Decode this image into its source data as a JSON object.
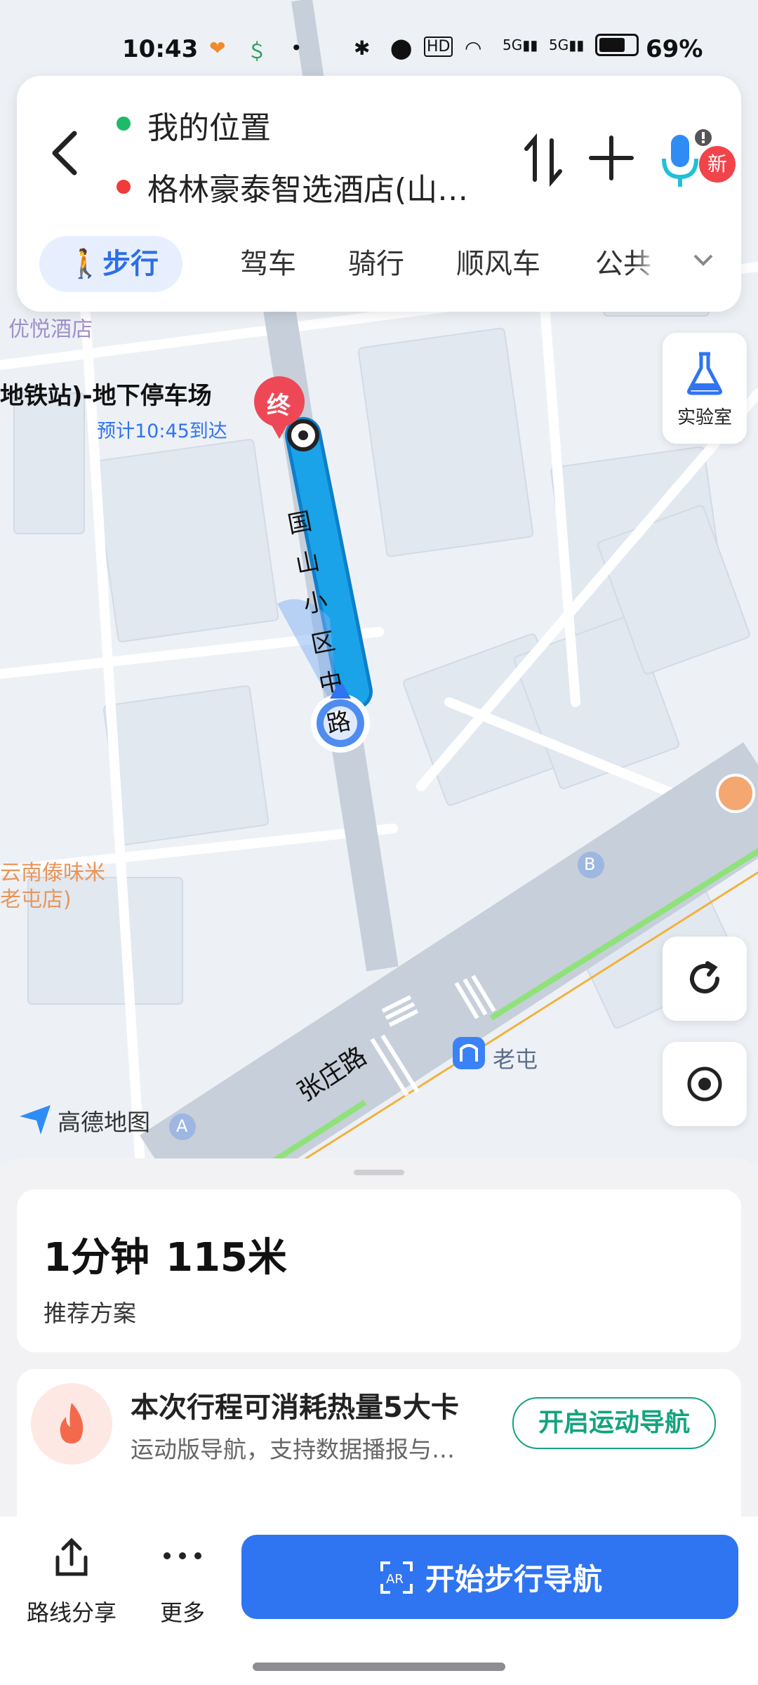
{
  "status_bar": {
    "time": "10:43",
    "network_1": "5G",
    "network_2": "5G",
    "battery": "69%"
  },
  "route": {
    "origin": "我的位置",
    "destination": "格林豪泰智选酒店(山…"
  },
  "tabs": [
    {
      "label": "步行",
      "active": true
    },
    {
      "label": "驾车"
    },
    {
      "label": "骑行"
    },
    {
      "label": "顺风车"
    },
    {
      "label": "公共"
    }
  ],
  "new_badge": "新",
  "lab_button": {
    "label": "实验室"
  },
  "map": {
    "poi_hotel": "优悦酒店",
    "poi_parking": "地铁站)-地下停车场",
    "eta": "预计10:45到达",
    "end_marker": "终",
    "street_route": "国山小区中路",
    "street_main": "张庄路",
    "poi_restaurant_1": "云南傣味米",
    "poi_restaurant_2": "老屯店)",
    "metro_station": "老屯",
    "bus_b": "B",
    "bus_a": "A",
    "logo": "高德地图"
  },
  "summary": {
    "time": "1分钟",
    "distance": "115米",
    "recommend": "推荐方案"
  },
  "calorie": {
    "title": "本次行程可消耗热量5大卡",
    "subtitle": "运动版导航，支持数据播报与…",
    "button": "开启运动导航"
  },
  "bottom": {
    "share": "路线分享",
    "more": "更多",
    "start_nav": "开始步行导航"
  },
  "colors": {
    "accent": "#2f74f1",
    "route": "#1aa3e8",
    "green_dot": "#1cbb6a",
    "red_dot": "#ef3b3b",
    "sport_green": "#14a37f"
  }
}
